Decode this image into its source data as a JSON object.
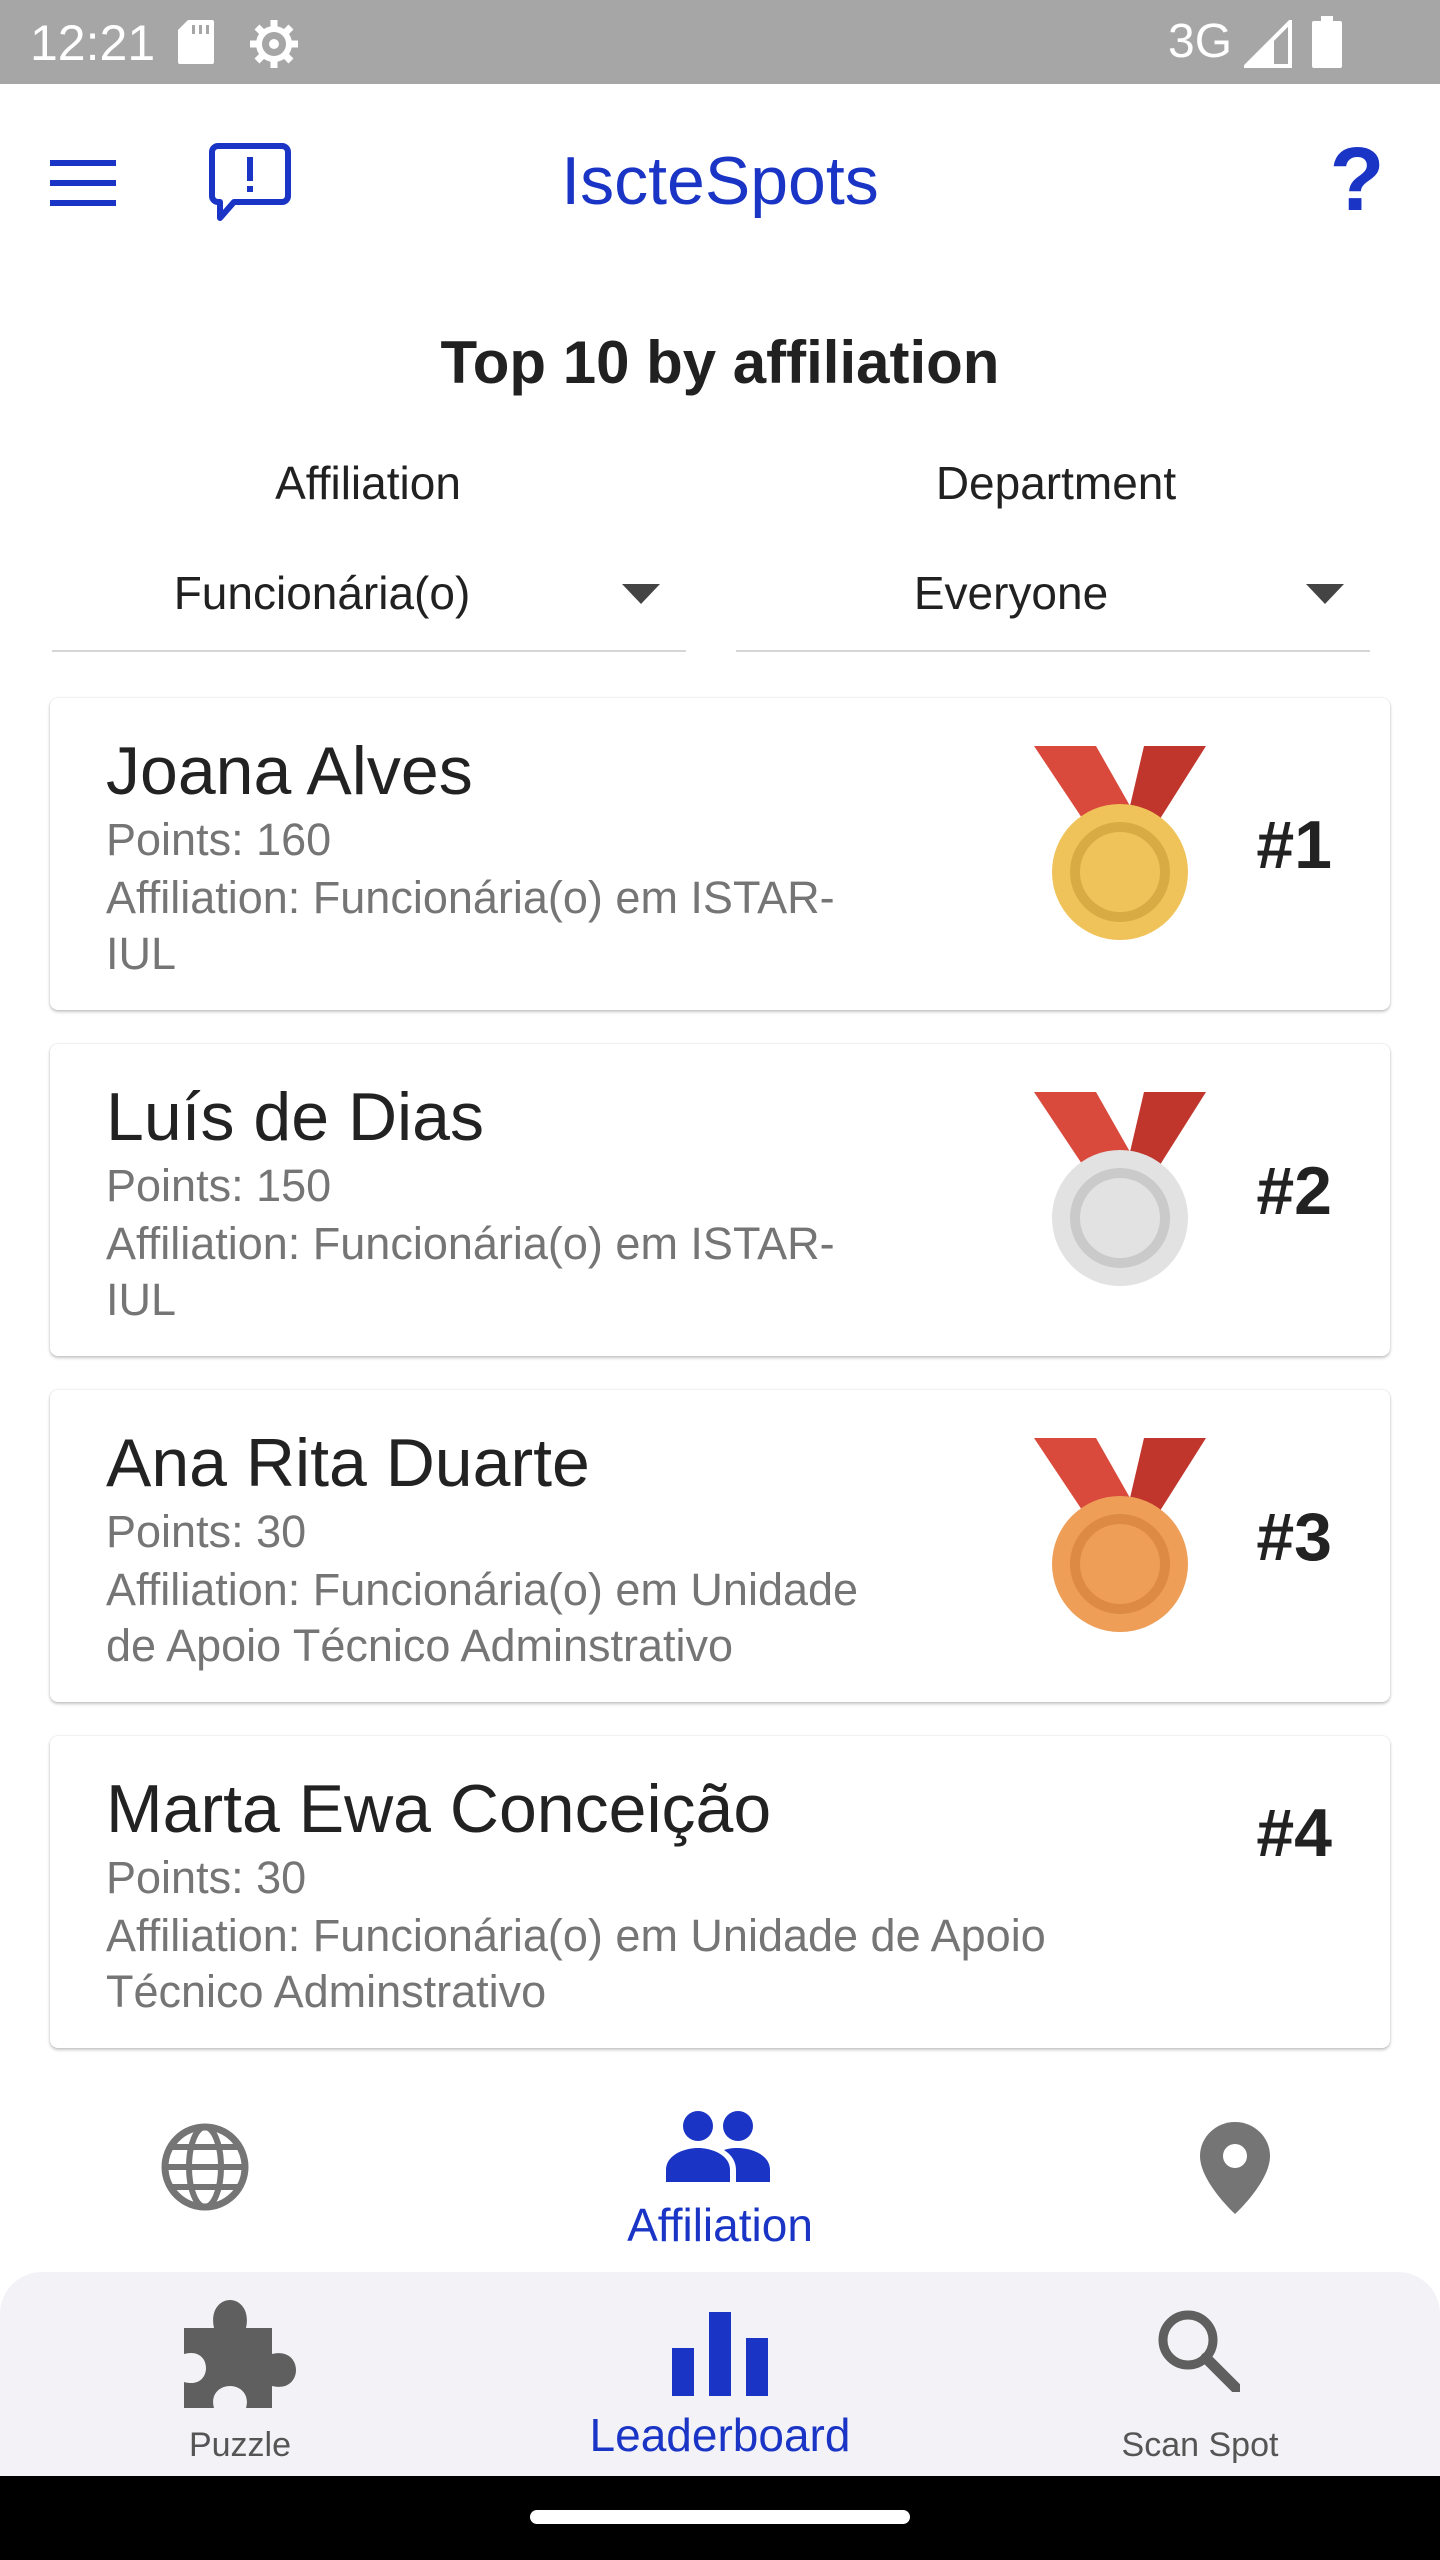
{
  "status_bar": {
    "time": "12:21",
    "network": "3G"
  },
  "app_bar": {
    "title": "IscteSpots",
    "help_label": "?"
  },
  "leaderboard": {
    "title": "Top 10 by affiliation",
    "filters": {
      "affiliation_label": "Affiliation",
      "affiliation_value": "Funcionária(o)",
      "department_label": "Department",
      "department_value": "Everyone"
    },
    "entries": [
      {
        "name": "Joana Alves",
        "points": "Points: 160",
        "affiliation_line1": "Affiliation: Funcionária(o) em ISTAR-",
        "affiliation_line2": "IUL",
        "rank": "#1",
        "medal": "gold"
      },
      {
        "name": "Luís de Dias",
        "points": "Points: 150",
        "affiliation_line1": "Affiliation: Funcionária(o) em ISTAR-",
        "affiliation_line2": "IUL",
        "rank": "#2",
        "medal": "silver"
      },
      {
        "name": "Ana Rita Duarte",
        "points": "Points: 30",
        "affiliation_line1": "Affiliation: Funcionária(o) em Unidade",
        "affiliation_line2": "de Apoio Técnico Adminstrativo",
        "rank": "#3",
        "medal": "bronze"
      },
      {
        "name": "Marta Ewa Conceição",
        "points": "Points: 30",
        "affiliation_line1": "Affiliation: Funcionária(o) em Unidade de Apoio",
        "affiliation_line2": "Técnico Adminstrativo",
        "rank": "#4",
        "medal": "none"
      }
    ]
  },
  "sub_nav": {
    "items": [
      {
        "icon": "globe-icon",
        "label": ""
      },
      {
        "icon": "people-icon",
        "label": "Affiliation",
        "selected": true
      },
      {
        "icon": "pin-icon",
        "label": ""
      }
    ]
  },
  "bottom_nav": {
    "items": [
      {
        "icon": "puzzle-icon",
        "label": "Puzzle"
      },
      {
        "icon": "bar-chart-icon",
        "label": "Leaderboard",
        "selected": true
      },
      {
        "icon": "search-icon",
        "label": "Scan Spot"
      }
    ]
  },
  "colors": {
    "accent": "#1a35c6",
    "status_bar": "#a6a6a6",
    "ribbon": "#d94a3d",
    "gold": "#f0c35a",
    "silver": "#e2e2e2",
    "bronze": "#ee9e57"
  }
}
